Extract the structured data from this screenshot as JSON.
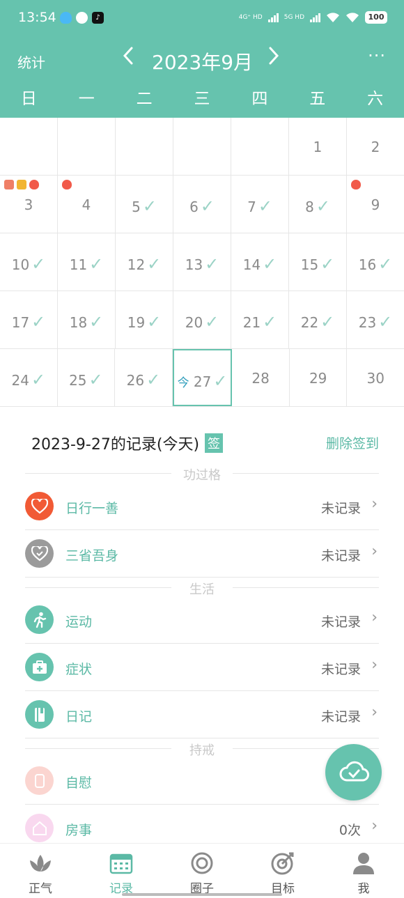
{
  "status_bar": {
    "time": "13:54",
    "network1": "4G⁺ HD",
    "network2": "5G HD",
    "battery": "100"
  },
  "toolbar": {
    "stats_label": "统计",
    "month_title": "2023年9月",
    "prev_icon": "chevron-left-icon",
    "next_icon": "chevron-right-icon",
    "more_label": "···"
  },
  "weekdays": [
    "日",
    "一",
    "二",
    "三",
    "四",
    "五",
    "六"
  ],
  "calendar": {
    "check_glyph": "✓",
    "today_label": "今",
    "weeks": [
      [
        {
          "d": ""
        },
        {
          "d": ""
        },
        {
          "d": ""
        },
        {
          "d": ""
        },
        {
          "d": ""
        },
        {
          "d": "1"
        },
        {
          "d": "2"
        }
      ],
      [
        {
          "d": "3"
        },
        {
          "d": "4"
        },
        {
          "d": "5"
        },
        {
          "d": "6"
        },
        {
          "d": "7"
        },
        {
          "d": "8"
        },
        {
          "d": "9"
        }
      ],
      [
        {
          "d": "10"
        },
        {
          "d": "11"
        },
        {
          "d": "12"
        },
        {
          "d": "13"
        },
        {
          "d": "14"
        },
        {
          "d": "15"
        },
        {
          "d": "16"
        }
      ],
      [
        {
          "d": "17"
        },
        {
          "d": "18"
        },
        {
          "d": "19"
        },
        {
          "d": "20"
        },
        {
          "d": "21"
        },
        {
          "d": "22"
        },
        {
          "d": "23"
        }
      ],
      [
        {
          "d": "24"
        },
        {
          "d": "25"
        },
        {
          "d": "26"
        },
        {
          "d": "27"
        },
        {
          "d": "28"
        },
        {
          "d": "29"
        },
        {
          "d": "30"
        }
      ]
    ]
  },
  "records": {
    "title": "2023-9-27的记录(今天)",
    "sign_badge": "签",
    "delete_label": "删除签到",
    "sections": {
      "merit": "功过格",
      "life": "生活",
      "precept": "持戒"
    },
    "items": [
      {
        "label": "日行一善",
        "status": "未记录",
        "icon": "heart-icon"
      },
      {
        "label": "三省吾身",
        "status": "未记录",
        "icon": "heart-check-icon"
      },
      {
        "label": "运动",
        "status": "未记录",
        "icon": "running-icon"
      },
      {
        "label": "症状",
        "status": "未记录",
        "icon": "medkit-icon"
      },
      {
        "label": "日记",
        "status": "未记录",
        "icon": "notebook-icon"
      },
      {
        "label": "自慰",
        "status": "",
        "icon": "cup-icon"
      },
      {
        "label": "房事",
        "status": "0次",
        "icon": "house-icon"
      }
    ]
  },
  "fab_icon": "cloud-sync-icon",
  "nav": {
    "tabs": [
      {
        "label": "正气",
        "icon": "lotus-icon"
      },
      {
        "label": "记录",
        "icon": "calendar-icon"
      },
      {
        "label": "圈子",
        "icon": "circle-icon"
      },
      {
        "label": "目标",
        "icon": "target-icon"
      },
      {
        "label": "我",
        "icon": "person-icon"
      }
    ]
  },
  "colors": {
    "brand": "#66c3ae",
    "check": "#9bd3c6",
    "today_text": "#2f9dbb",
    "heart": "#f15a35",
    "gray_icon": "#9b9b9b",
    "faded_pink": "#fbd5d0",
    "faded_magenta": "#f9d8ef"
  }
}
